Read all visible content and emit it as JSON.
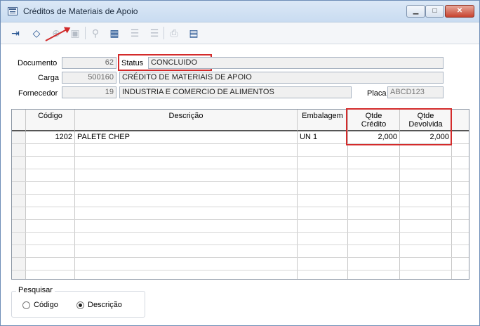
{
  "window": {
    "title": "Créditos de Materiais de Apoio",
    "controls": {
      "minimize": "▁",
      "maximize": "□",
      "close": "✕"
    }
  },
  "toolbar": {
    "buttons": [
      {
        "name": "exit",
        "icon": "exit-icon",
        "glyph": "⇥",
        "enabled": true
      },
      {
        "name": "clear",
        "icon": "eraser-icon",
        "glyph": "◇",
        "enabled": true
      },
      {
        "name": "add",
        "icon": "add-icon",
        "glyph": "⊕",
        "enabled": false
      },
      {
        "name": "save",
        "icon": "save-icon",
        "glyph": "▣",
        "enabled": false
      },
      {
        "name": "search",
        "icon": "search-icon",
        "glyph": "⚲",
        "enabled": false
      },
      {
        "name": "grid",
        "icon": "table-icon",
        "glyph": "▦",
        "enabled": true
      },
      {
        "name": "add-row",
        "icon": "add-row-icon",
        "glyph": "☰",
        "enabled": false
      },
      {
        "name": "remove-row",
        "icon": "remove-row-icon",
        "glyph": "☰",
        "enabled": false
      },
      {
        "name": "print",
        "icon": "print-icon",
        "glyph": "⎙",
        "enabled": false
      },
      {
        "name": "report",
        "icon": "document-icon",
        "glyph": "▤",
        "enabled": true
      }
    ]
  },
  "form": {
    "documento": {
      "label": "Documento",
      "value": "62"
    },
    "status": {
      "label": "Status",
      "value": "CONCLUIDO"
    },
    "carga": {
      "label": "Carga",
      "value": "500160",
      "description": "CRÉDITO DE MATERIAIS DE APOIO"
    },
    "fornecedor": {
      "label": "Fornecedor",
      "value": "19",
      "description": "INDUSTRIA E COMERCIO DE ALIMENTOS"
    },
    "placa": {
      "label": "Placa",
      "value": "ABCD123"
    }
  },
  "grid": {
    "columns": {
      "codigo": "Código",
      "descricao": "Descrição",
      "embalagem": "Embalagem",
      "qtde_credito_1": "Qtde",
      "qtde_credito_2": "Crédito",
      "qtde_devolvida_1": "Qtde",
      "qtde_devolvida_2": "Devolvida"
    },
    "rows": [
      {
        "codigo": "1202",
        "descricao": "PALETE CHEP",
        "embalagem": "UN 1",
        "qtde_credito": "2,000",
        "qtde_devolvida": "2,000"
      }
    ]
  },
  "search": {
    "title": "Pesquisar",
    "options": [
      {
        "label": "Código",
        "selected": false
      },
      {
        "label": "Descrição",
        "selected": true
      }
    ]
  },
  "colors": {
    "highlight": "#d42b2b",
    "titlebar": "#c9dcf1",
    "toolbar_icon": "#1f4f8f"
  }
}
